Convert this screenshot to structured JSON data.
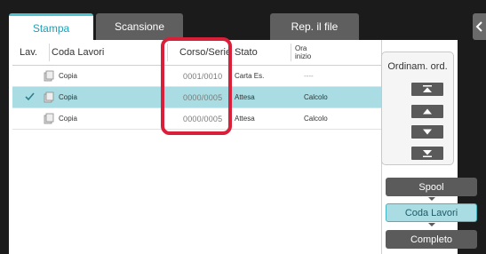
{
  "tabs": [
    {
      "label": "Stampa",
      "active": true
    },
    {
      "label": "Scansione",
      "active": false
    },
    {
      "label": "Rep. il file",
      "active": false
    }
  ],
  "columns": {
    "lav": "Lav.",
    "coda_lavori": "Coda Lavori",
    "corso_serie": "Corso/Serie",
    "stato": "Stato",
    "ora_inizio": "Ora\ninizio"
  },
  "jobs": [
    {
      "name": "Copia",
      "progress": "0001/0010",
      "status": "Carta Es.",
      "time": "----",
      "selected": false
    },
    {
      "name": "Copia",
      "progress": "0000/0005",
      "status": "Attesa",
      "time": "Calcolo",
      "selected": true
    },
    {
      "name": "Copia",
      "progress": "0000/0005",
      "status": "Attesa",
      "time": "Calcolo",
      "selected": false
    }
  ],
  "sort": {
    "title": "Ordinam. ord.",
    "buttons": [
      "move-to-top",
      "move-up",
      "move-down",
      "move-to-bottom"
    ]
  },
  "modes": {
    "spool": "Spool",
    "coda_lavori": "Coda Lavori",
    "completo": "Completo",
    "selected": "Coda Lavori"
  },
  "colors": {
    "accent": "#4fc2cf",
    "selection": "#a9dde3",
    "highlight": "#d8203a"
  }
}
